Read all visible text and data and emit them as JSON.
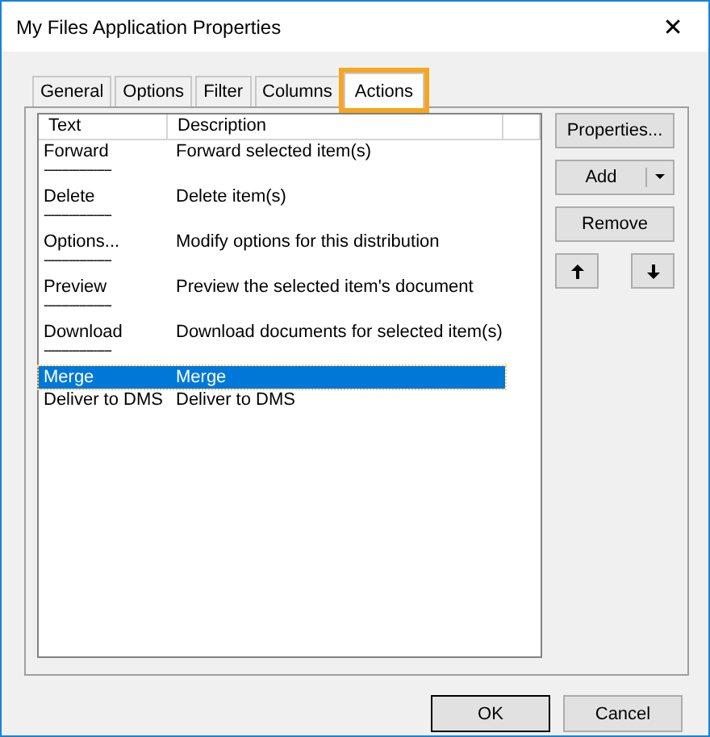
{
  "window": {
    "title": "My Files Application Properties",
    "close": "✕"
  },
  "tabs": [
    {
      "label": "General",
      "selected": false,
      "highlighted": false
    },
    {
      "label": "Options",
      "selected": false,
      "highlighted": false
    },
    {
      "label": "Filter",
      "selected": false,
      "highlighted": false
    },
    {
      "label": "Columns",
      "selected": false,
      "highlighted": false
    },
    {
      "label": "Actions",
      "selected": true,
      "highlighted": true
    }
  ],
  "list": {
    "columns": [
      "Text",
      "Description"
    ],
    "rows": [
      {
        "kind": "item",
        "text": "Forward",
        "description": "Forward selected item(s)",
        "selected": false
      },
      {
        "kind": "separator",
        "text": "-------------------"
      },
      {
        "kind": "item",
        "text": "Delete",
        "description": "Delete item(s)",
        "selected": false
      },
      {
        "kind": "separator",
        "text": "-------------------"
      },
      {
        "kind": "item",
        "text": "Options...",
        "description": "Modify options for this distribution",
        "selected": false
      },
      {
        "kind": "separator",
        "text": "-------------------"
      },
      {
        "kind": "item",
        "text": "Preview",
        "description": "Preview the selected item's document",
        "selected": false
      },
      {
        "kind": "separator",
        "text": "-------------------"
      },
      {
        "kind": "item",
        "text": "Download",
        "description": "Download documents for selected item(s)",
        "selected": false
      },
      {
        "kind": "separator",
        "text": "-------------------"
      },
      {
        "kind": "item",
        "text": "Merge",
        "description": "Merge",
        "selected": true
      },
      {
        "kind": "item",
        "text": "Deliver to DMS",
        "description": "Deliver to DMS",
        "selected": false
      }
    ]
  },
  "side_buttons": {
    "properties": "Properties...",
    "add": "Add",
    "remove": "Remove"
  },
  "buttons": [
    "OK",
    "Cancel"
  ]
}
